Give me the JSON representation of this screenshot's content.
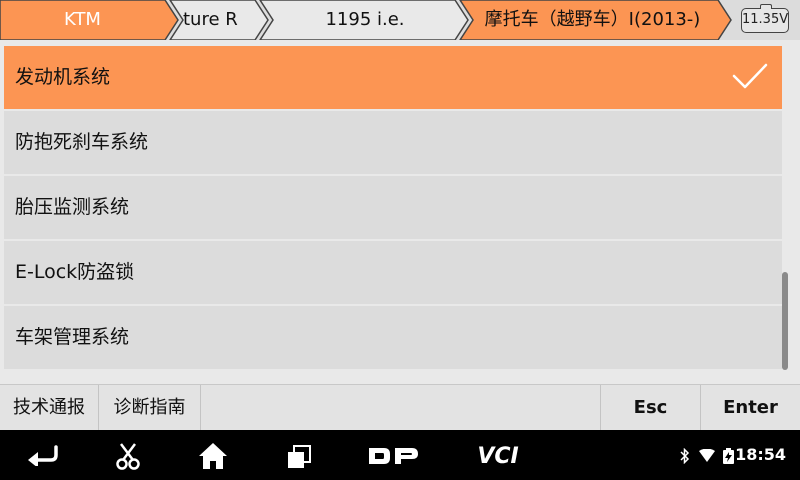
{
  "breadcrumb": {
    "items": [
      "KTM",
      "ture R",
      "1195 i.e.",
      "摩托车（越野车）I(2013-)"
    ],
    "active_color": "#fc9553"
  },
  "battery": {
    "voltage": "11.35V"
  },
  "list": {
    "items": [
      {
        "label": "发动机系统",
        "selected": true
      },
      {
        "label": "防抱死刹车系统",
        "selected": false
      },
      {
        "label": "胎压监测系统",
        "selected": false
      },
      {
        "label": "E-Lock防盗锁",
        "selected": false
      },
      {
        "label": "车架管理系统",
        "selected": false
      }
    ],
    "selected_color": "#fc9553",
    "selected_icon": "check-icon"
  },
  "actions": {
    "tech_bulletin": "技术通报",
    "diag_guide": "诊断指南",
    "esc": "Esc",
    "enter": "Enter"
  },
  "navbar": {
    "icons": [
      "back-icon",
      "scissors-icon",
      "home-icon",
      "recent-apps-icon",
      "dp-logo-icon",
      "vci-icon"
    ],
    "dp_label": "DP",
    "vci_label": "VCI"
  },
  "status": {
    "time": "18:54",
    "icons": [
      "bluetooth-icon",
      "wifi-icon",
      "battery-charging-icon"
    ]
  }
}
